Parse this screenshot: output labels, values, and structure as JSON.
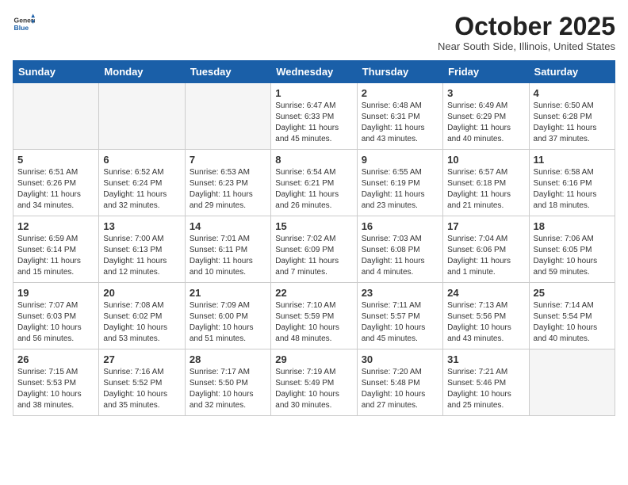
{
  "header": {
    "logo_general": "General",
    "logo_blue": "Blue",
    "month_title": "October 2025",
    "subtitle": "Near South Side, Illinois, United States"
  },
  "weekdays": [
    "Sunday",
    "Monday",
    "Tuesday",
    "Wednesday",
    "Thursday",
    "Friday",
    "Saturday"
  ],
  "weeks": [
    [
      {
        "day": "",
        "empty": true
      },
      {
        "day": "",
        "empty": true
      },
      {
        "day": "",
        "empty": true
      },
      {
        "day": "1",
        "info": "Sunrise: 6:47 AM\nSunset: 6:33 PM\nDaylight: 11 hours\nand 45 minutes."
      },
      {
        "day": "2",
        "info": "Sunrise: 6:48 AM\nSunset: 6:31 PM\nDaylight: 11 hours\nand 43 minutes."
      },
      {
        "day": "3",
        "info": "Sunrise: 6:49 AM\nSunset: 6:29 PM\nDaylight: 11 hours\nand 40 minutes."
      },
      {
        "day": "4",
        "info": "Sunrise: 6:50 AM\nSunset: 6:28 PM\nDaylight: 11 hours\nand 37 minutes."
      }
    ],
    [
      {
        "day": "5",
        "info": "Sunrise: 6:51 AM\nSunset: 6:26 PM\nDaylight: 11 hours\nand 34 minutes."
      },
      {
        "day": "6",
        "info": "Sunrise: 6:52 AM\nSunset: 6:24 PM\nDaylight: 11 hours\nand 32 minutes."
      },
      {
        "day": "7",
        "info": "Sunrise: 6:53 AM\nSunset: 6:23 PM\nDaylight: 11 hours\nand 29 minutes."
      },
      {
        "day": "8",
        "info": "Sunrise: 6:54 AM\nSunset: 6:21 PM\nDaylight: 11 hours\nand 26 minutes."
      },
      {
        "day": "9",
        "info": "Sunrise: 6:55 AM\nSunset: 6:19 PM\nDaylight: 11 hours\nand 23 minutes."
      },
      {
        "day": "10",
        "info": "Sunrise: 6:57 AM\nSunset: 6:18 PM\nDaylight: 11 hours\nand 21 minutes."
      },
      {
        "day": "11",
        "info": "Sunrise: 6:58 AM\nSunset: 6:16 PM\nDaylight: 11 hours\nand 18 minutes."
      }
    ],
    [
      {
        "day": "12",
        "info": "Sunrise: 6:59 AM\nSunset: 6:14 PM\nDaylight: 11 hours\nand 15 minutes."
      },
      {
        "day": "13",
        "info": "Sunrise: 7:00 AM\nSunset: 6:13 PM\nDaylight: 11 hours\nand 12 minutes."
      },
      {
        "day": "14",
        "info": "Sunrise: 7:01 AM\nSunset: 6:11 PM\nDaylight: 11 hours\nand 10 minutes."
      },
      {
        "day": "15",
        "info": "Sunrise: 7:02 AM\nSunset: 6:09 PM\nDaylight: 11 hours\nand 7 minutes."
      },
      {
        "day": "16",
        "info": "Sunrise: 7:03 AM\nSunset: 6:08 PM\nDaylight: 11 hours\nand 4 minutes."
      },
      {
        "day": "17",
        "info": "Sunrise: 7:04 AM\nSunset: 6:06 PM\nDaylight: 11 hours\nand 1 minute."
      },
      {
        "day": "18",
        "info": "Sunrise: 7:06 AM\nSunset: 6:05 PM\nDaylight: 10 hours\nand 59 minutes."
      }
    ],
    [
      {
        "day": "19",
        "info": "Sunrise: 7:07 AM\nSunset: 6:03 PM\nDaylight: 10 hours\nand 56 minutes."
      },
      {
        "day": "20",
        "info": "Sunrise: 7:08 AM\nSunset: 6:02 PM\nDaylight: 10 hours\nand 53 minutes."
      },
      {
        "day": "21",
        "info": "Sunrise: 7:09 AM\nSunset: 6:00 PM\nDaylight: 10 hours\nand 51 minutes."
      },
      {
        "day": "22",
        "info": "Sunrise: 7:10 AM\nSunset: 5:59 PM\nDaylight: 10 hours\nand 48 minutes."
      },
      {
        "day": "23",
        "info": "Sunrise: 7:11 AM\nSunset: 5:57 PM\nDaylight: 10 hours\nand 45 minutes."
      },
      {
        "day": "24",
        "info": "Sunrise: 7:13 AM\nSunset: 5:56 PM\nDaylight: 10 hours\nand 43 minutes."
      },
      {
        "day": "25",
        "info": "Sunrise: 7:14 AM\nSunset: 5:54 PM\nDaylight: 10 hours\nand 40 minutes."
      }
    ],
    [
      {
        "day": "26",
        "info": "Sunrise: 7:15 AM\nSunset: 5:53 PM\nDaylight: 10 hours\nand 38 minutes."
      },
      {
        "day": "27",
        "info": "Sunrise: 7:16 AM\nSunset: 5:52 PM\nDaylight: 10 hours\nand 35 minutes."
      },
      {
        "day": "28",
        "info": "Sunrise: 7:17 AM\nSunset: 5:50 PM\nDaylight: 10 hours\nand 32 minutes."
      },
      {
        "day": "29",
        "info": "Sunrise: 7:19 AM\nSunset: 5:49 PM\nDaylight: 10 hours\nand 30 minutes."
      },
      {
        "day": "30",
        "info": "Sunrise: 7:20 AM\nSunset: 5:48 PM\nDaylight: 10 hours\nand 27 minutes."
      },
      {
        "day": "31",
        "info": "Sunrise: 7:21 AM\nSunset: 5:46 PM\nDaylight: 10 hours\nand 25 minutes."
      },
      {
        "day": "",
        "empty": true
      }
    ]
  ]
}
